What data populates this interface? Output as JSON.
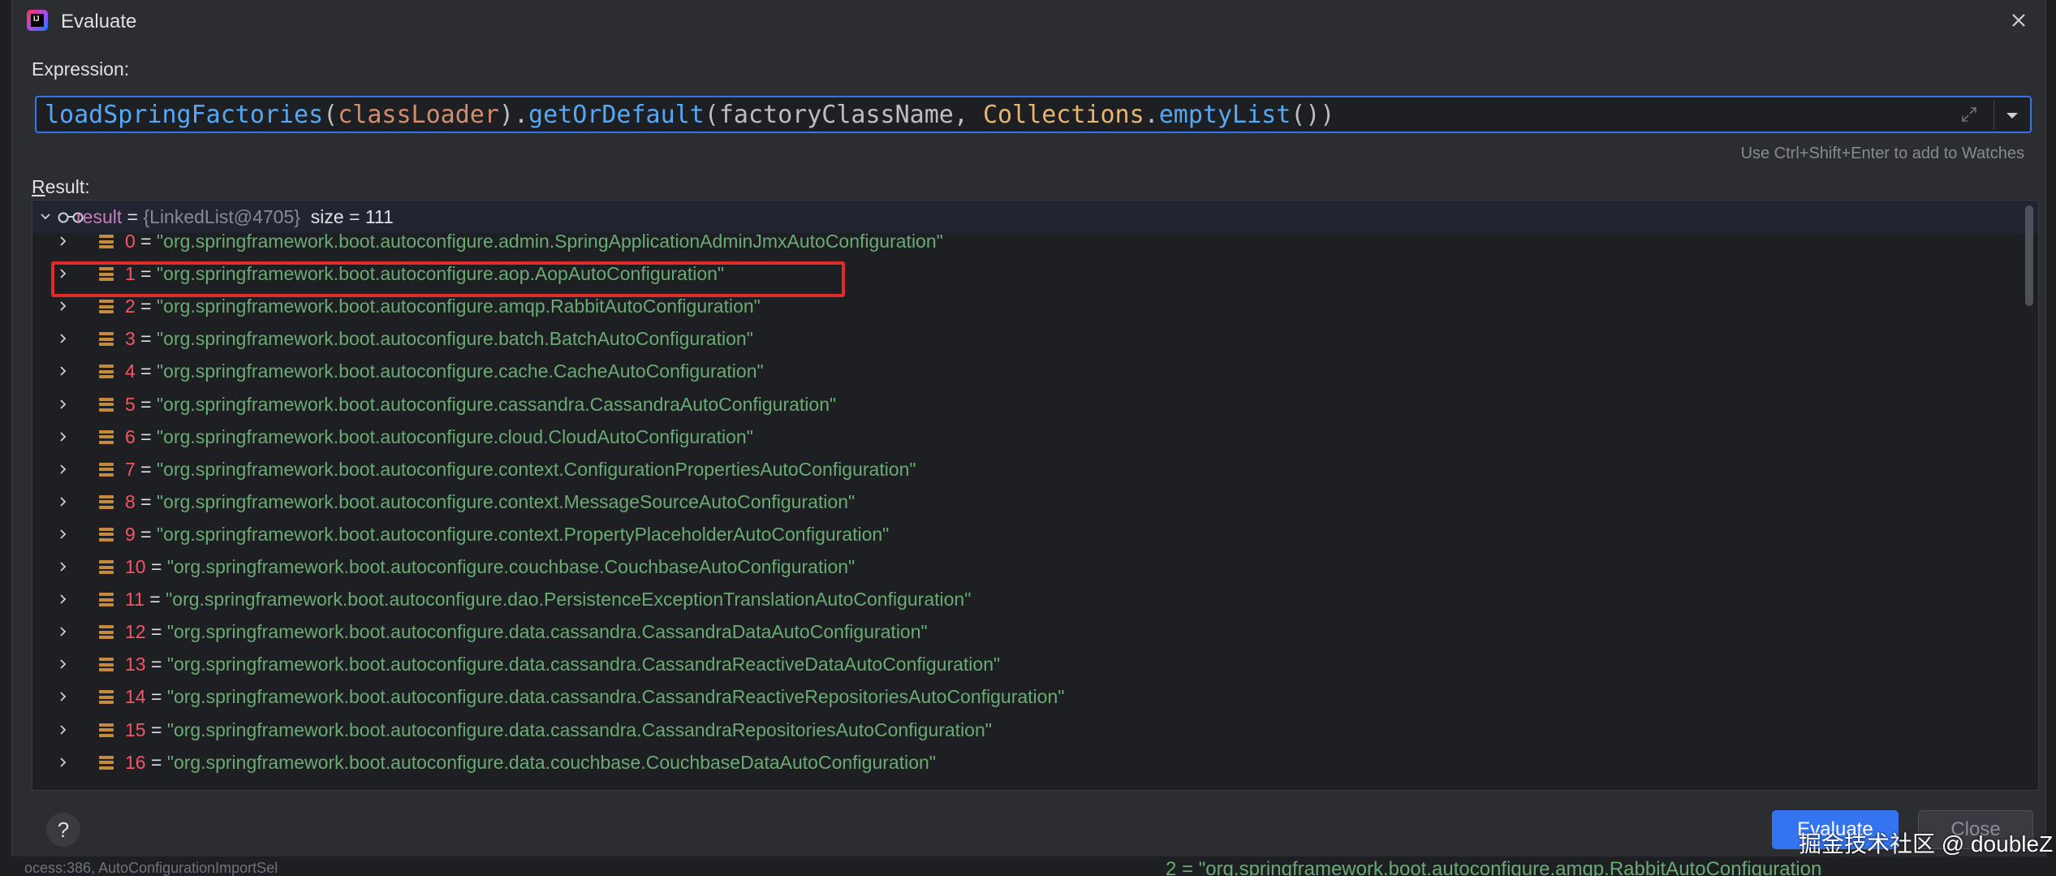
{
  "window": {
    "title": "Evaluate"
  },
  "expression": {
    "label": "Expression:",
    "tokens": [
      {
        "text": "loadSpringFactories",
        "cls": "c-method"
      },
      {
        "text": "(",
        "cls": "c-plain"
      },
      {
        "text": "classLoader",
        "cls": "c-orange"
      },
      {
        "text": ").",
        "cls": "c-plain"
      },
      {
        "text": "getOrDefault",
        "cls": "c-method"
      },
      {
        "text": "(",
        "cls": "c-plain"
      },
      {
        "text": "factoryClassName",
        "cls": "c-plain"
      },
      {
        "text": ", ",
        "cls": "c-plain"
      },
      {
        "text": "Collections",
        "cls": "c-class"
      },
      {
        "text": ".",
        "cls": "c-plain"
      },
      {
        "text": "emptyList",
        "cls": "c-method"
      },
      {
        "text": "())",
        "cls": "c-plain"
      }
    ],
    "hint": "Use Ctrl+Shift+Enter to add to Watches"
  },
  "result": {
    "label_prefix": "R",
    "label_rest": "esult:",
    "root": {
      "name": "result",
      "equals": " = ",
      "type_ref": "{LinkedList@4705}",
      "size": "size = 111"
    },
    "items": [
      {
        "index": "0",
        "value": "\"org.springframework.boot.autoconfigure.admin.SpringApplicationAdminJmxAutoConfiguration\""
      },
      {
        "index": "1",
        "value": "\"org.springframework.boot.autoconfigure.aop.AopAutoConfiguration\""
      },
      {
        "index": "2",
        "value": "\"org.springframework.boot.autoconfigure.amqp.RabbitAutoConfiguration\""
      },
      {
        "index": "3",
        "value": "\"org.springframework.boot.autoconfigure.batch.BatchAutoConfiguration\""
      },
      {
        "index": "4",
        "value": "\"org.springframework.boot.autoconfigure.cache.CacheAutoConfiguration\""
      },
      {
        "index": "5",
        "value": "\"org.springframework.boot.autoconfigure.cassandra.CassandraAutoConfiguration\""
      },
      {
        "index": "6",
        "value": "\"org.springframework.boot.autoconfigure.cloud.CloudAutoConfiguration\""
      },
      {
        "index": "7",
        "value": "\"org.springframework.boot.autoconfigure.context.ConfigurationPropertiesAutoConfiguration\""
      },
      {
        "index": "8",
        "value": "\"org.springframework.boot.autoconfigure.context.MessageSourceAutoConfiguration\""
      },
      {
        "index": "9",
        "value": "\"org.springframework.boot.autoconfigure.context.PropertyPlaceholderAutoConfiguration\""
      },
      {
        "index": "10",
        "value": "\"org.springframework.boot.autoconfigure.couchbase.CouchbaseAutoConfiguration\""
      },
      {
        "index": "11",
        "value": "\"org.springframework.boot.autoconfigure.dao.PersistenceExceptionTranslationAutoConfiguration\""
      },
      {
        "index": "12",
        "value": "\"org.springframework.boot.autoconfigure.data.cassandra.CassandraDataAutoConfiguration\""
      },
      {
        "index": "13",
        "value": "\"org.springframework.boot.autoconfigure.data.cassandra.CassandraReactiveDataAutoConfiguration\""
      },
      {
        "index": "14",
        "value": "\"org.springframework.boot.autoconfigure.data.cassandra.CassandraReactiveRepositoriesAutoConfiguration\""
      },
      {
        "index": "15",
        "value": "\"org.springframework.boot.autoconfigure.data.cassandra.CassandraRepositoriesAutoConfiguration\""
      },
      {
        "index": "16",
        "value": "\"org.springframework.boot.autoconfigure.data.couchbase.CouchbaseDataAutoConfiguration\""
      }
    ],
    "highlighted_index": 1
  },
  "buttons": {
    "help": "?",
    "evaluate": "Evaluate",
    "close": "Close"
  },
  "background": {
    "bottom_left": "ocess:386, AutoConfigurationImportSel",
    "bottom_right": "2 = \"org.springframework.boot.autoconfigure.amqp.RabbitAutoConfiguration"
  },
  "watermark": "掘金技术社区 @ doubleZ",
  "colors": {
    "accent": "#3574f0",
    "highlight": "#e12a2a",
    "string": "#6aab73",
    "index": "#f75464"
  }
}
